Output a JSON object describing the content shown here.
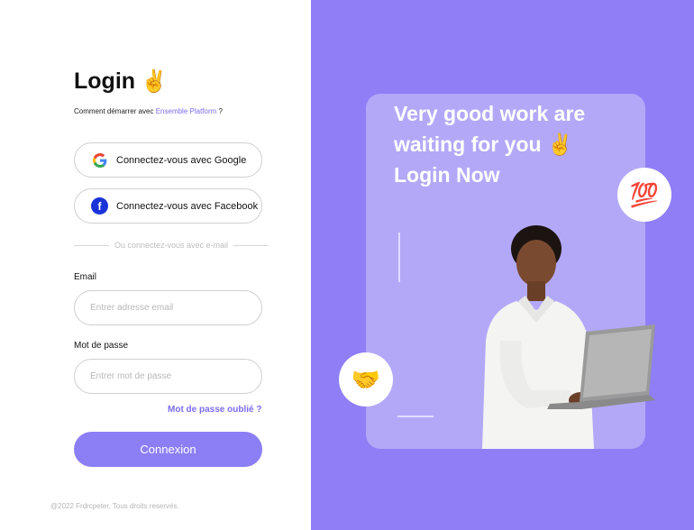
{
  "login": {
    "title": "Login",
    "title_emoji": "✌️",
    "subtitle_prefix": "Comment démarrer avec ",
    "subtitle_link": "Ensemble Platform",
    "subtitle_suffix": " ?",
    "google_label": "Connectez-vous avec Google",
    "facebook_label": "Connectez-vous avec Facebook",
    "divider_text": "Ou connectez-vous avec e-mail",
    "email_label": "Email",
    "email_placeholder": "Entrer adresse email",
    "password_label": "Mot de passe",
    "password_placeholder": "Entrer mot de passe",
    "forgot_label": "Mot de passe  oublié ?",
    "submit_label": "Connexion",
    "footer": "@2022 Frdrcpeter, Tous droits  reservés."
  },
  "promo": {
    "headline_line1": "Very good work are",
    "headline_line2": "waiting for you ✌️",
    "headline_line3": "Login Now",
    "emoji_hundred": "💯",
    "emoji_handshake": "🤝"
  },
  "colors": {
    "accent": "#7b6cf0",
    "button": "#8c7ef4",
    "panel": "#8f7ef5",
    "card": "#b3a8f8"
  },
  "icons": {
    "google": "google-icon",
    "facebook": "facebook-icon"
  }
}
